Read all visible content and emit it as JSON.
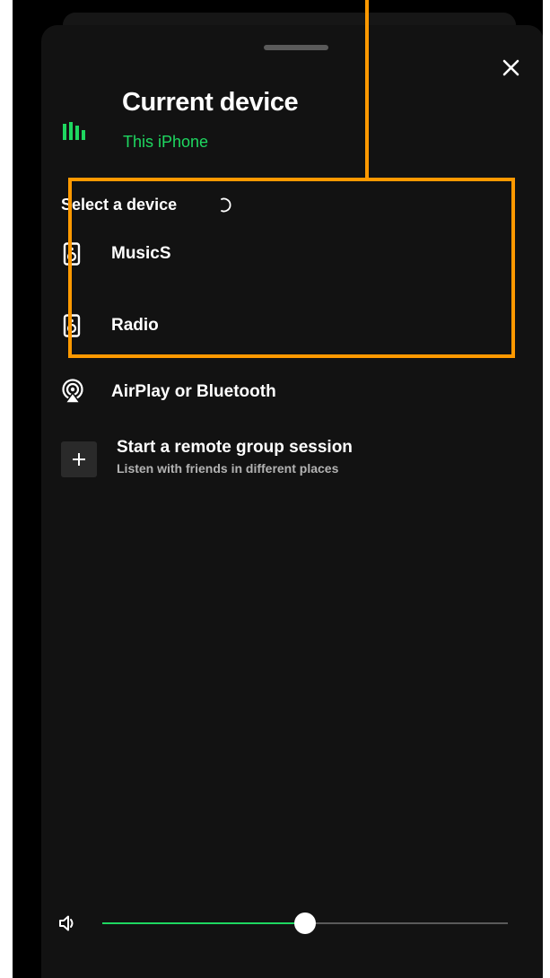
{
  "sheet": {
    "close_icon": "close-icon"
  },
  "current_device": {
    "icon": "equalizer-bars-icon",
    "title": "Current device",
    "subtitle": "This iPhone",
    "accent_color": "#1ed760"
  },
  "select_device": {
    "label": "Select a device",
    "loading_icon": "spinner-icon",
    "devices": [
      {
        "label": "MusicS",
        "icon": "speaker-icon"
      },
      {
        "label": "Radio",
        "icon": "speaker-icon"
      }
    ]
  },
  "airplay": {
    "label": "AirPlay or Bluetooth",
    "icon": "airplay-icon"
  },
  "group_session": {
    "title": "Start a remote group session",
    "subtitle": "Listen with friends in different places",
    "icon": "plus-icon"
  },
  "volume": {
    "icon": "volume-icon",
    "level": 0.5
  },
  "annotation": {
    "highlight_color": "#ff9900"
  }
}
